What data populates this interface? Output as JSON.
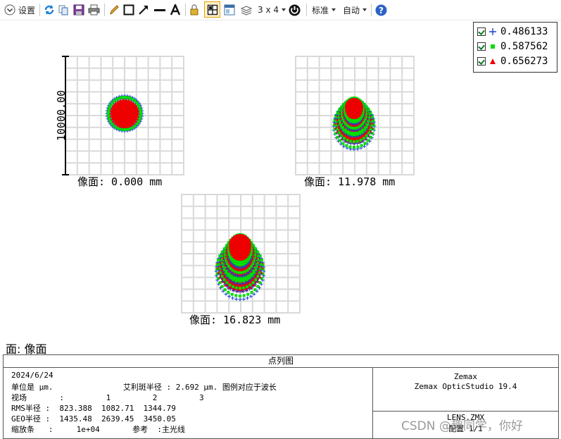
{
  "toolbar": {
    "settings_label": "设置",
    "layout_label": "3 x 4",
    "standard_label": "标准",
    "auto_label": "自动"
  },
  "legend": {
    "items": [
      {
        "value": "0.486133",
        "marker": "plus",
        "color": "#1a3fd6"
      },
      {
        "value": "0.587562",
        "marker": "square",
        "color": "#00dd00"
      },
      {
        "value": "0.656273",
        "marker": "triangle",
        "color": "#ee0000"
      }
    ]
  },
  "plots": [
    {
      "field_label": "像面: 0.000 mm",
      "scale_label": "10000.00"
    },
    {
      "field_label": "像面: 11.978 mm"
    },
    {
      "field_label": "像面: 16.823 mm"
    }
  ],
  "surface_label": "面: 像面",
  "info": {
    "title": "点列图",
    "lines": [
      "2024/6/24",
      "单位是 μm.               艾利斑半径 : 2.692 μm. 图例对应于波长",
      "视场       :         1         2         3",
      "RMS半径 :  823.388  1082.71  1344.79",
      "GEO半径 :  1435.48  2639.45  3450.05",
      "缩放条   :     1e+04       参考  :主光线"
    ],
    "right_lines": [
      "Zemax",
      "Zemax OpticStudio 19.4",
      "",
      "LENS.ZMX",
      "配置 1/1"
    ]
  },
  "watermark": "CSDN @趣同学，你好",
  "colors": {
    "blue": "#1a3fd6",
    "green": "#00dd00",
    "red": "#ee0000",
    "grid": "#d9d9d9"
  }
}
